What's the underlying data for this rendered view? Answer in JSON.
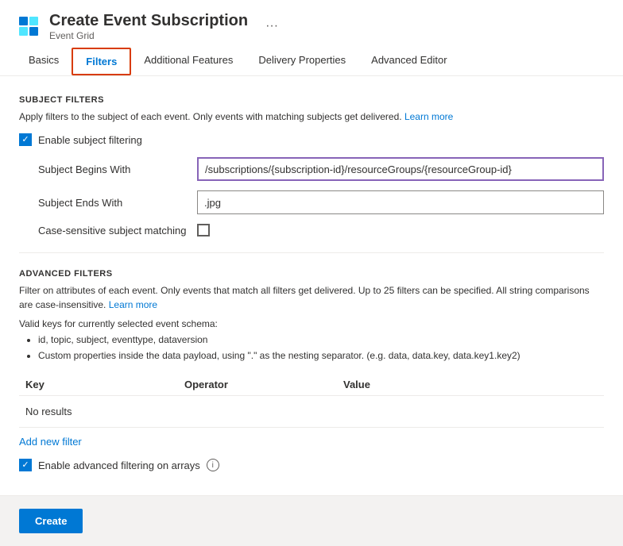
{
  "header": {
    "title": "Create Event Subscription",
    "subtitle": "Event Grid",
    "more_icon": "···"
  },
  "tabs": [
    {
      "id": "basics",
      "label": "Basics",
      "active": false
    },
    {
      "id": "filters",
      "label": "Filters",
      "active": true
    },
    {
      "id": "additional-features",
      "label": "Additional Features",
      "active": false
    },
    {
      "id": "delivery-properties",
      "label": "Delivery Properties",
      "active": false
    },
    {
      "id": "advanced-editor",
      "label": "Advanced Editor",
      "active": false
    }
  ],
  "subject_filters": {
    "section_title": "SUBJECT FILTERS",
    "description": "Apply filters to the subject of each event. Only events with matching subjects get delivered.",
    "learn_more": "Learn more",
    "enable_checkbox_label": "Enable subject filtering",
    "enable_checked": true,
    "subject_begins_with": {
      "label": "Subject Begins With",
      "value": "/subscriptions/{subscription-id}/resourceGroups/{resourceGroup-id}",
      "focused": true
    },
    "subject_ends_with": {
      "label": "Subject Ends With",
      "value": ".jpg",
      "focused": false
    },
    "case_sensitive": {
      "label": "Case-sensitive subject matching",
      "checked": false
    }
  },
  "advanced_filters": {
    "section_title": "ADVANCED FILTERS",
    "description": "Filter on attributes of each event. Only events that match all filters get delivered. Up to 25 filters can be specified. All string comparisons are case-insensitive.",
    "learn_more": "Learn more",
    "valid_keys_intro": "Valid keys for currently selected event schema:",
    "bullet_items": [
      "id, topic, subject, eventtype, dataversion",
      "Custom properties inside the data payload, using \".\" as the nesting separator. (e.g. data, data.key, data.key1.key2)"
    ],
    "table": {
      "columns": [
        "Key",
        "Operator",
        "Value"
      ],
      "empty_message": "No results"
    },
    "add_filter_label": "Add new filter",
    "enable_adv_arrays_label": "Enable advanced filtering on arrays",
    "enable_adv_arrays_checked": true
  },
  "footer": {
    "create_button": "Create"
  }
}
